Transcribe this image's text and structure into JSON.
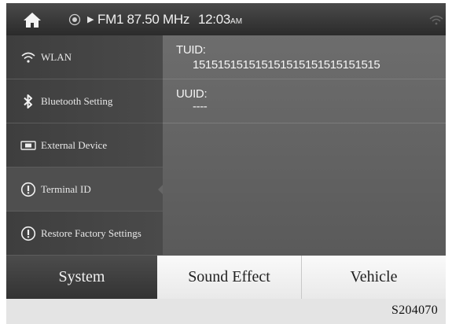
{
  "status_bar": {
    "radio": "FM1 87.50 MHz",
    "time": "12:03",
    "ampm": "AM"
  },
  "sidebar": {
    "items": [
      {
        "label": "WLAN",
        "icon": "wifi-icon"
      },
      {
        "label": "Bluetooth Setting",
        "icon": "bluetooth-icon"
      },
      {
        "label": "External Device",
        "icon": "external-device-icon"
      },
      {
        "label": "Terminal ID",
        "icon": "info-icon",
        "active": true
      },
      {
        "label": "Restore Factory Settings",
        "icon": "info-icon"
      }
    ]
  },
  "content": {
    "rows": [
      {
        "label": "TUID:",
        "value": "151515151515151515151515151515"
      },
      {
        "label": "UUID:",
        "value": "----"
      }
    ]
  },
  "tabs": [
    {
      "label": "System",
      "active": true
    },
    {
      "label": "Sound Effect"
    },
    {
      "label": "Vehicle"
    }
  ],
  "figure_code": "S204070",
  "colors": {
    "status_bar": "#333333",
    "sidebar": "#444444",
    "content": "#646464",
    "active_tab": "#3c3c3c",
    "inactive_tab": "#f0f0f0"
  }
}
